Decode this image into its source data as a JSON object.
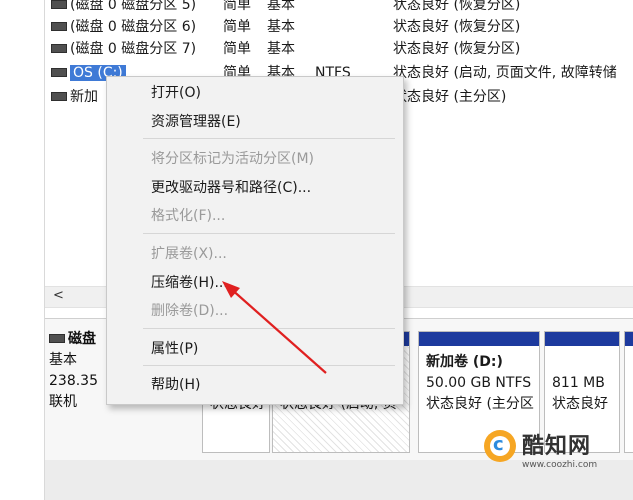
{
  "volumes": [
    {
      "name": "(磁盘 0 磁盘分区 5)",
      "layout": "简单",
      "type": "基本",
      "fs": "",
      "status": "状态良好 (恢复分区)"
    },
    {
      "name": "(磁盘 0 磁盘分区 6)",
      "layout": "简单",
      "type": "基本",
      "fs": "",
      "status": "状态良好 (恢复分区)"
    },
    {
      "name": "(磁盘 0 磁盘分区 7)",
      "layout": "简单",
      "type": "基本",
      "fs": "",
      "status": "状态良好 (恢复分区)"
    },
    {
      "name": "OS (C:)",
      "layout": "简单",
      "type": "基本",
      "fs": "NTFS",
      "status": "状态良好 (启动, 页面文件, 故障转储"
    },
    {
      "name": "新加",
      "layout": "",
      "type": "",
      "fs": "",
      "status": "状态良好 (主分区)"
    }
  ],
  "scroll": {
    "left_arrow": "<"
  },
  "disk": {
    "title": "磁盘",
    "type": "基本",
    "size": "238.35",
    "state": "联机"
  },
  "segments": [
    {
      "name": "",
      "size": "",
      "status": "状态良好"
    },
    {
      "name": "",
      "size": "",
      "status": "状态良好 (启动, 页"
    },
    {
      "name": "新加卷 (D:)",
      "size": "50.00 GB NTFS",
      "status": "状态良好 (主分区"
    },
    {
      "name": "",
      "size": "811 MB",
      "status": "状态良好"
    },
    {
      "name": "",
      "size": "",
      "status": ""
    }
  ],
  "context_menu": {
    "open": "打开(O)",
    "explorer": "资源管理器(E)",
    "mark_active": "将分区标记为活动分区(M)",
    "change_letter": "更改驱动器号和路径(C)...",
    "format": "格式化(F)...",
    "extend": "扩展卷(X)...",
    "shrink": "压缩卷(H)...",
    "delete": "删除卷(D)...",
    "properties": "属性(P)",
    "help": "帮助(H)"
  },
  "watermark": {
    "name": "酷知网",
    "url": "www.coozhi.com"
  },
  "colors": {
    "selection": "#3f7ad6",
    "partition_bar": "#1d3a9e",
    "arrow": "#e02020",
    "watermark_orange": "#f6a623"
  }
}
